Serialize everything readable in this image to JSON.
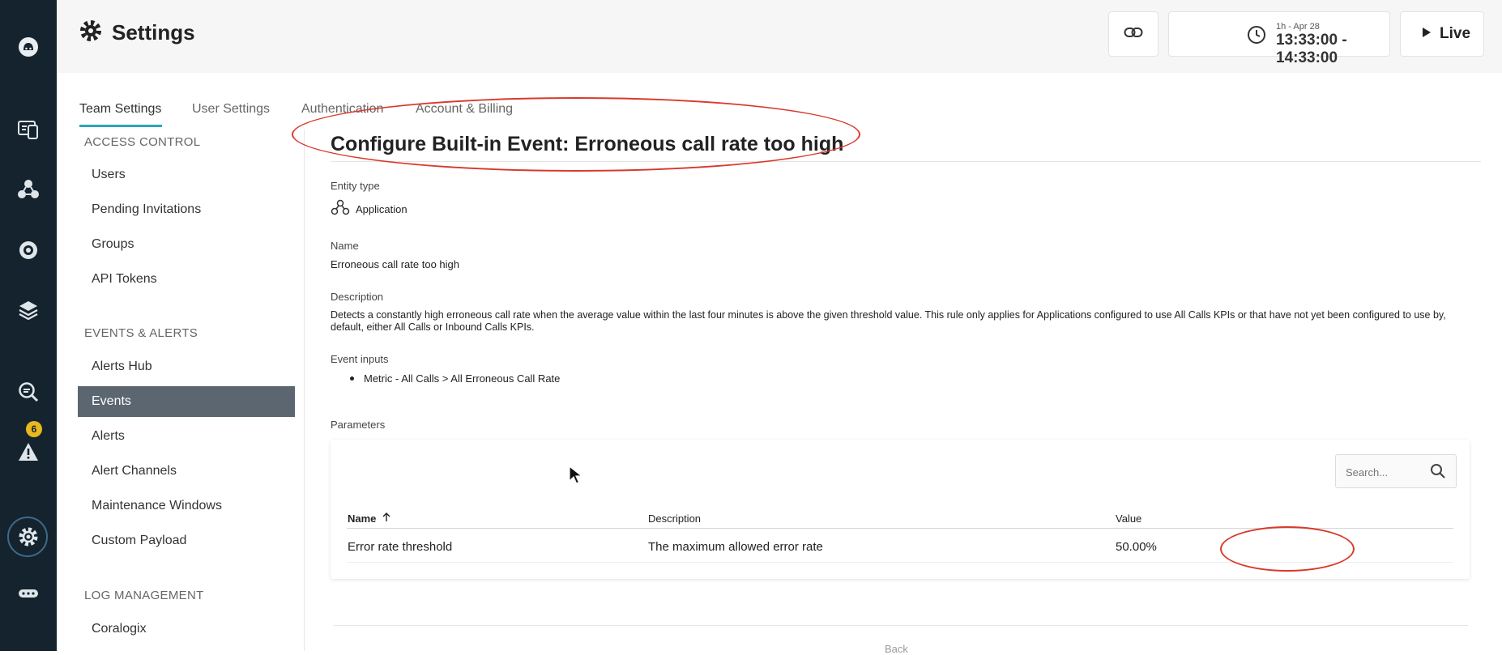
{
  "rail": {
    "icons": [
      "logo-icon",
      "monitor-icon",
      "application-icon",
      "infrastructure-icon",
      "layers-icon",
      "analyze-icon",
      "alerts-icon",
      "settings-icon",
      "more-icon"
    ],
    "alerts_badge": "6"
  },
  "header": {
    "title": "Settings",
    "time_range_small": "1h - Apr 28",
    "time_range": "13:33:00 - 14:33:00",
    "live_label": "Live"
  },
  "tabs": [
    "Team Settings",
    "User Settings",
    "Authentication",
    "Account & Billing"
  ],
  "subnav": {
    "access_control_heading": "ACCESS CONTROL",
    "access_control_items": [
      "Users",
      "Pending Invitations",
      "Groups",
      "API Tokens"
    ],
    "events_alerts_heading": "EVENTS & ALERTS",
    "events_alerts_items": [
      "Alerts Hub",
      "Events",
      "Alerts",
      "Alert Channels",
      "Maintenance Windows",
      "Custom Payload"
    ],
    "log_management_heading": "LOG MANAGEMENT",
    "log_management_items": [
      "Coralogix"
    ]
  },
  "config": {
    "title": "Configure Built-in Event: Erroneous call rate too high",
    "entity_type_label": "Entity type",
    "entity_type_value": "Application",
    "name_label": "Name",
    "name_value": "Erroneous call rate too high",
    "description_label": "Description",
    "description_value": "Detects a constantly high erroneous call rate when the average value within the last four minutes is above the given threshold value. This rule only applies for Applications configured to use All Calls KPIs or that have not yet been configured to use by, default, either All Calls or Inbound Calls KPIs.",
    "event_inputs_label": "Event inputs",
    "event_inputs": [
      "Metric - All Calls > All Erroneous Call Rate"
    ],
    "parameters_label": "Parameters"
  },
  "parameters_table": {
    "search_placeholder": "Search...",
    "columns": [
      "Name",
      "Description",
      "Value"
    ],
    "rows": [
      {
        "name": "Error rate threshold",
        "description": "The maximum allowed error rate",
        "value": "50.00%"
      }
    ]
  },
  "footer": {
    "back_label": "Back"
  },
  "colors": {
    "rail": "#14232e",
    "accent": "#2aa7b8",
    "active_nav": "#5c6670",
    "annotation": "#d9392b",
    "badge": "#e8b820"
  }
}
